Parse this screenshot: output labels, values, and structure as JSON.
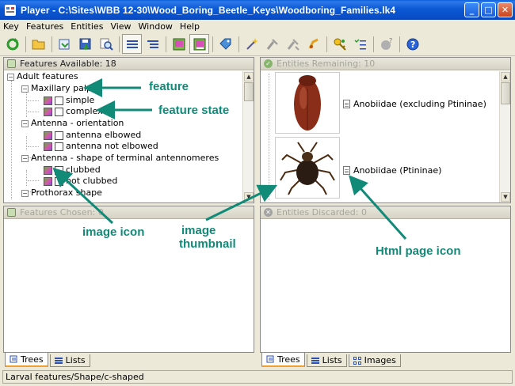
{
  "window": {
    "title": "Player - C:\\Sites\\WBB 12-30\\Wood_Boring_Beetle_Keys\\Woodboring_Families.lk4",
    "minimize": "_",
    "maximize": "□",
    "close": "✕"
  },
  "menu": [
    "Key",
    "Features",
    "Entities",
    "View",
    "Window",
    "Help"
  ],
  "toolbar_icons": [
    "refresh-icon",
    "open-folder-icon",
    "restore-icon",
    "save-icon",
    "find-icon",
    "list-view-icon",
    "outline-view-icon",
    "image-icon",
    "image-selected-icon",
    "tag-icon",
    "wand-icon",
    "prune-icon",
    "unprune-icon",
    "ballot-icon",
    "key-search-icon",
    "checklist-icon",
    "unknown-icon",
    "help-icon"
  ],
  "features_panel": {
    "title": "Features Available: 18",
    "tree": [
      {
        "label": "Adult features",
        "level": 0,
        "kind": "group"
      },
      {
        "label": "Maxillary palps",
        "level": 1,
        "kind": "feature"
      },
      {
        "label": "simple",
        "level": 2,
        "kind": "state"
      },
      {
        "label": "complex",
        "level": 2,
        "kind": "state"
      },
      {
        "label": "Antenna - orientation",
        "level": 1,
        "kind": "feature"
      },
      {
        "label": "antenna elbowed",
        "level": 2,
        "kind": "state"
      },
      {
        "label": "antenna not elbowed",
        "level": 2,
        "kind": "state"
      },
      {
        "label": "Antenna - shape of terminal antennomeres",
        "level": 1,
        "kind": "feature"
      },
      {
        "label": "clubbed",
        "level": 2,
        "kind": "state"
      },
      {
        "label": "not clubbed",
        "level": 2,
        "kind": "state"
      },
      {
        "label": "Prothorax shape",
        "level": 1,
        "kind": "feature"
      }
    ]
  },
  "chosen_panel": {
    "title": "Features Chosen: 0"
  },
  "remaining_panel": {
    "title": "Entities Remaining: 10",
    "entities": [
      {
        "label": "Anobiidae (excluding Ptininae)"
      },
      {
        "label": "Anobiidae (Ptininae)"
      }
    ]
  },
  "discarded_panel": {
    "title": "Entities Discarded: 0"
  },
  "left_tabs": [
    {
      "label": "Trees",
      "active": true
    },
    {
      "label": "Lists",
      "active": false
    }
  ],
  "right_tabs": [
    {
      "label": "Trees",
      "active": true
    },
    {
      "label": "Lists",
      "active": false
    },
    {
      "label": "Images",
      "active": false
    }
  ],
  "status": "Larval features/Shape/c-shaped",
  "annotations": {
    "feature": "feature",
    "feature_state": "feature state",
    "image_icon": "image icon",
    "image_thumbnail_1": "image",
    "image_thumbnail_2": "thumbnail",
    "html_page_icon": "Html page icon"
  },
  "colors": {
    "annotation": "#118a78",
    "titlebar": "#0a58d4"
  }
}
